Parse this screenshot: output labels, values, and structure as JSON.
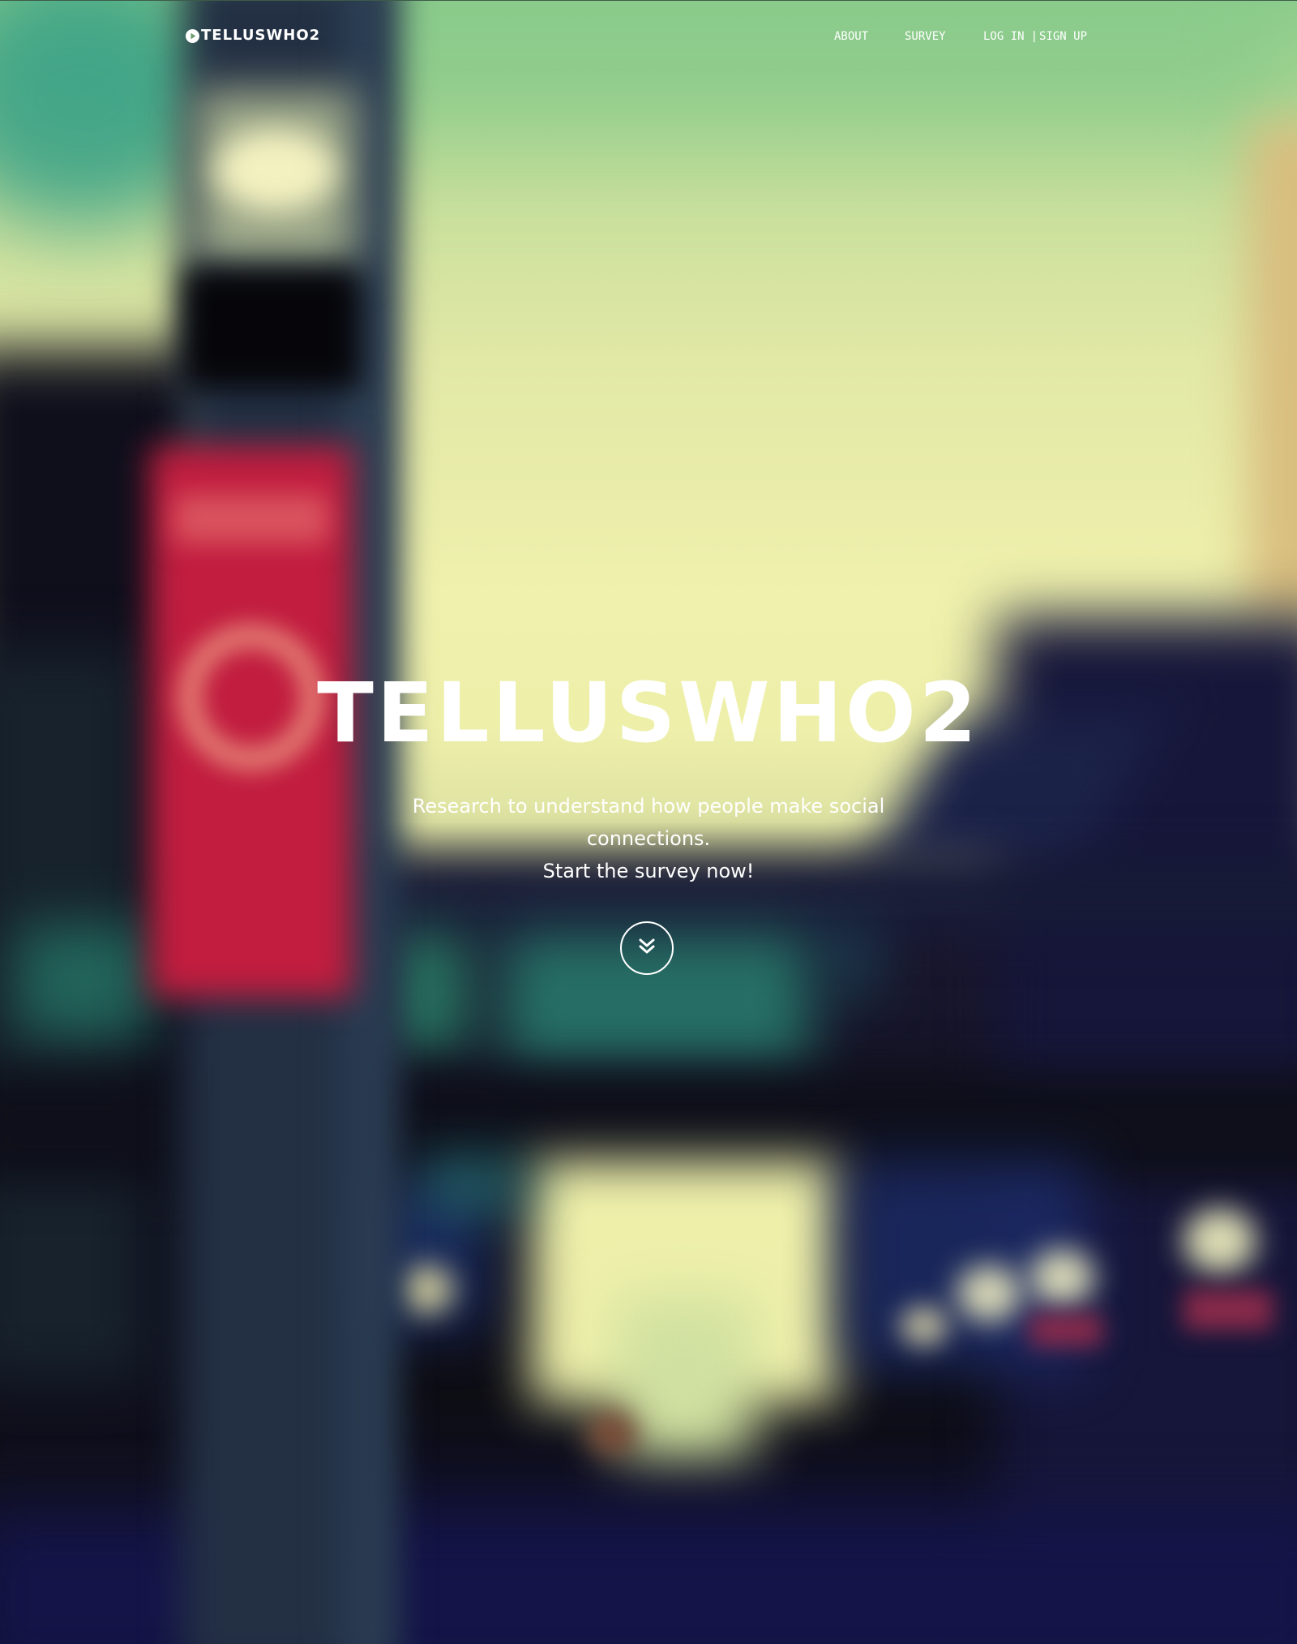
{
  "header": {
    "brand": {
      "icon": "play-circle-icon",
      "name": "TELLUSWHO2"
    },
    "nav": {
      "about": "ABOUT",
      "survey": "SURVEY",
      "login": "LOG IN",
      "separator": "|",
      "signup": "SIGN UP"
    }
  },
  "hero": {
    "title": "TELLUSWHO2",
    "tagline": "Research to understand how people make social connections.",
    "cta": "Start the survey now!",
    "scroll_icon": "double-chevron-down-icon"
  },
  "colors": {
    "text": "#ffffff",
    "banner_red": "#c21d3f",
    "sky_green": "#8fce8c",
    "sky_yellow": "#eff1ac",
    "night_navy": "#141448"
  }
}
